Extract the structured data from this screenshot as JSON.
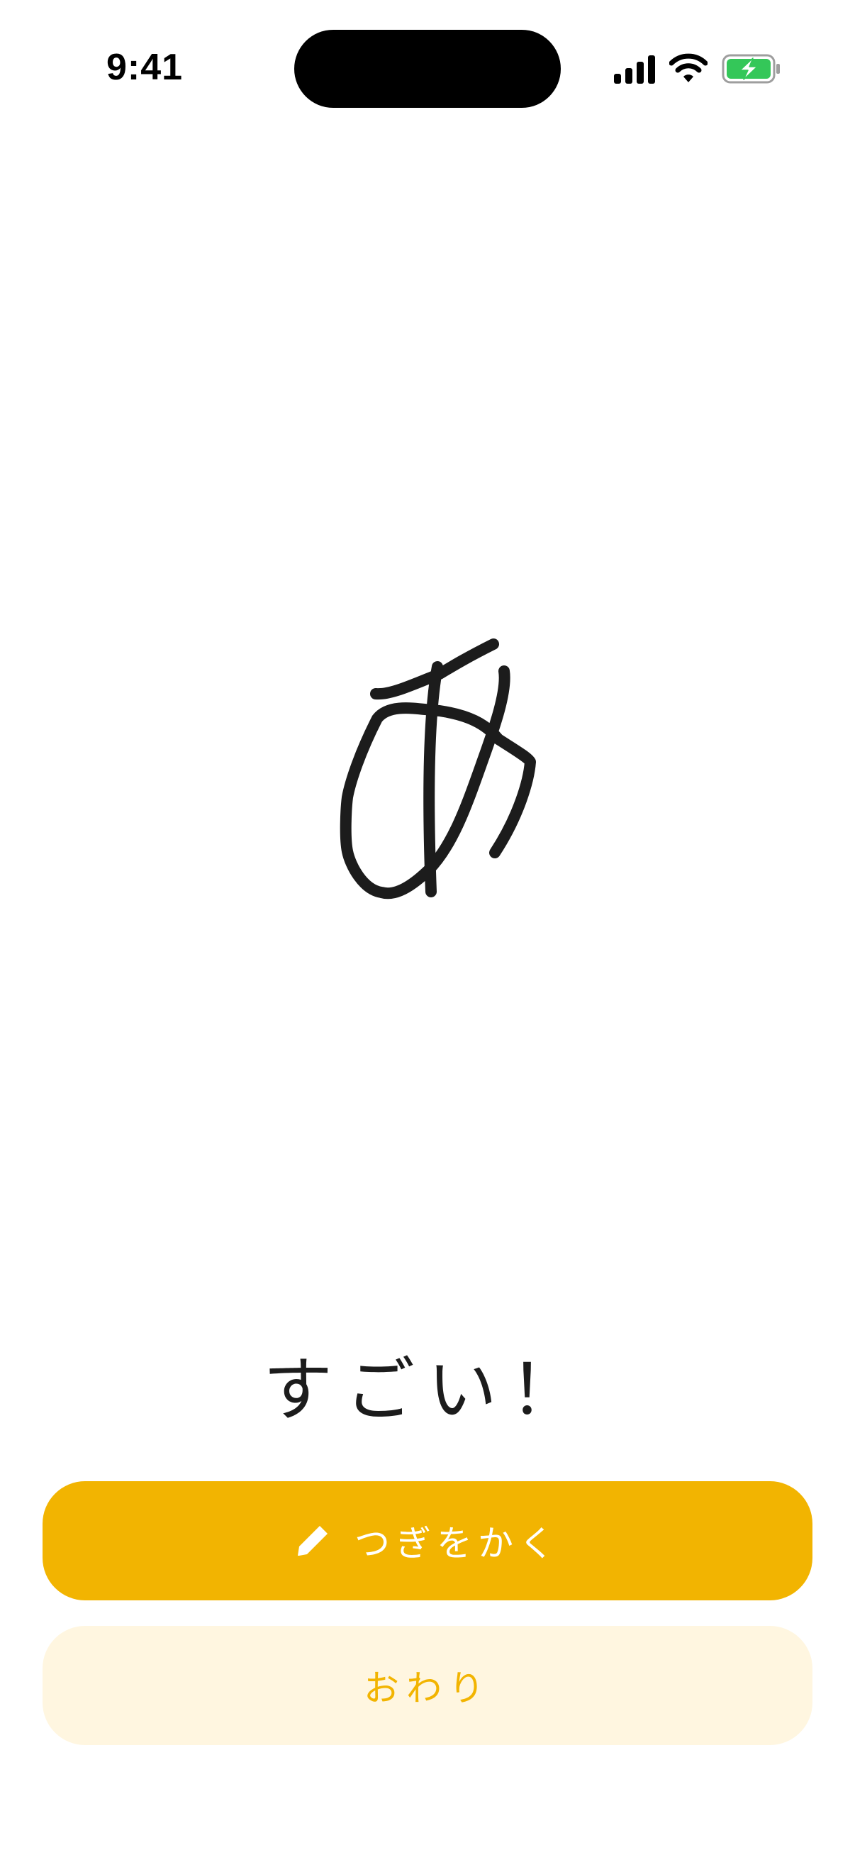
{
  "status_bar": {
    "time": "9:41",
    "icons": [
      "signal-icon",
      "wifi-icon",
      "battery-charging-icon"
    ],
    "battery_color": "#34c759"
  },
  "canvas": {
    "drawn_character": "あ",
    "stroke_color": "#1c1c1c"
  },
  "result": {
    "praise_text": "すごい！"
  },
  "actions": {
    "next_label": "つぎをかく",
    "next_icon": "pencil-icon",
    "finish_label": "おわり"
  },
  "colors": {
    "accent": "#f2b401",
    "accent_light": "#fff6e0",
    "background": "#ffffff"
  }
}
